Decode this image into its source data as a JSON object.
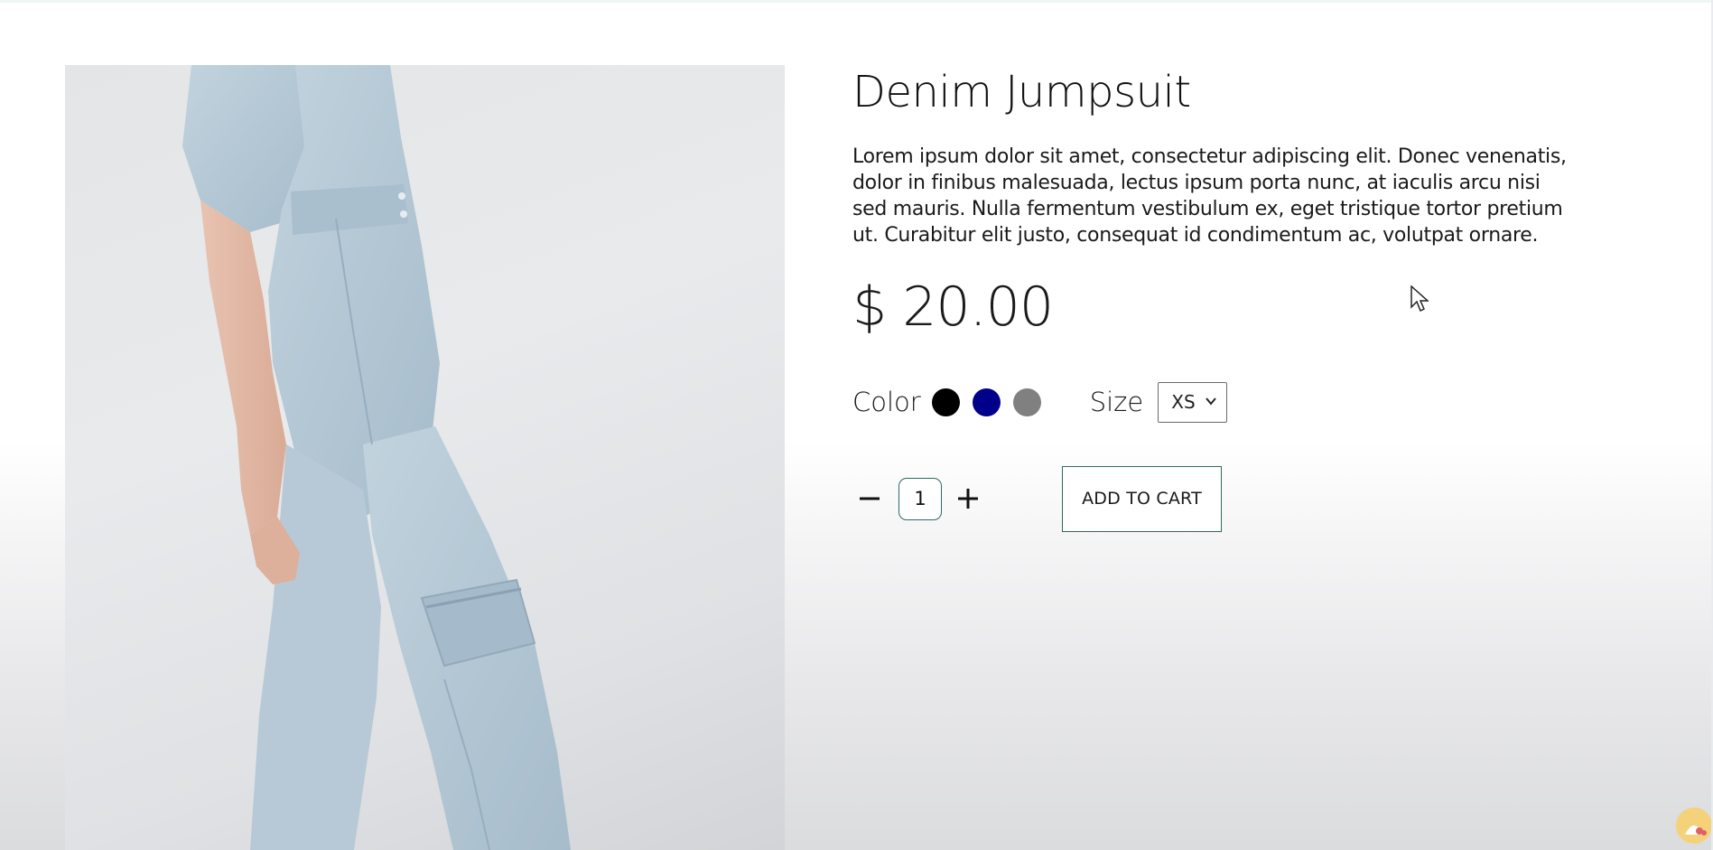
{
  "product": {
    "title": "Denim Jumpsuit",
    "description": "Lorem ipsum dolor sit amet, consectetur adipiscing elit. Donec venenatis, dolor in finibus malesuada, lectus ipsum porta nunc, at iaculis arcu nisi sed mauris. Nulla fermentum vestibulum ex, eget tristique tortor pretium ut. Curabitur elit justo, consequat id condimentum ac, volutpat ornare.",
    "price": "$ 20.00",
    "image_icon": "denim-jumpsuit-photo"
  },
  "options": {
    "color_label": "Color",
    "colors": [
      "#000000",
      "#00008b",
      "#808080"
    ],
    "size_label": "Size",
    "size_value": "XS"
  },
  "cart": {
    "quantity": "1",
    "add_label": "ADD TO CART"
  },
  "colors": {
    "accent": "#2f6b62"
  }
}
